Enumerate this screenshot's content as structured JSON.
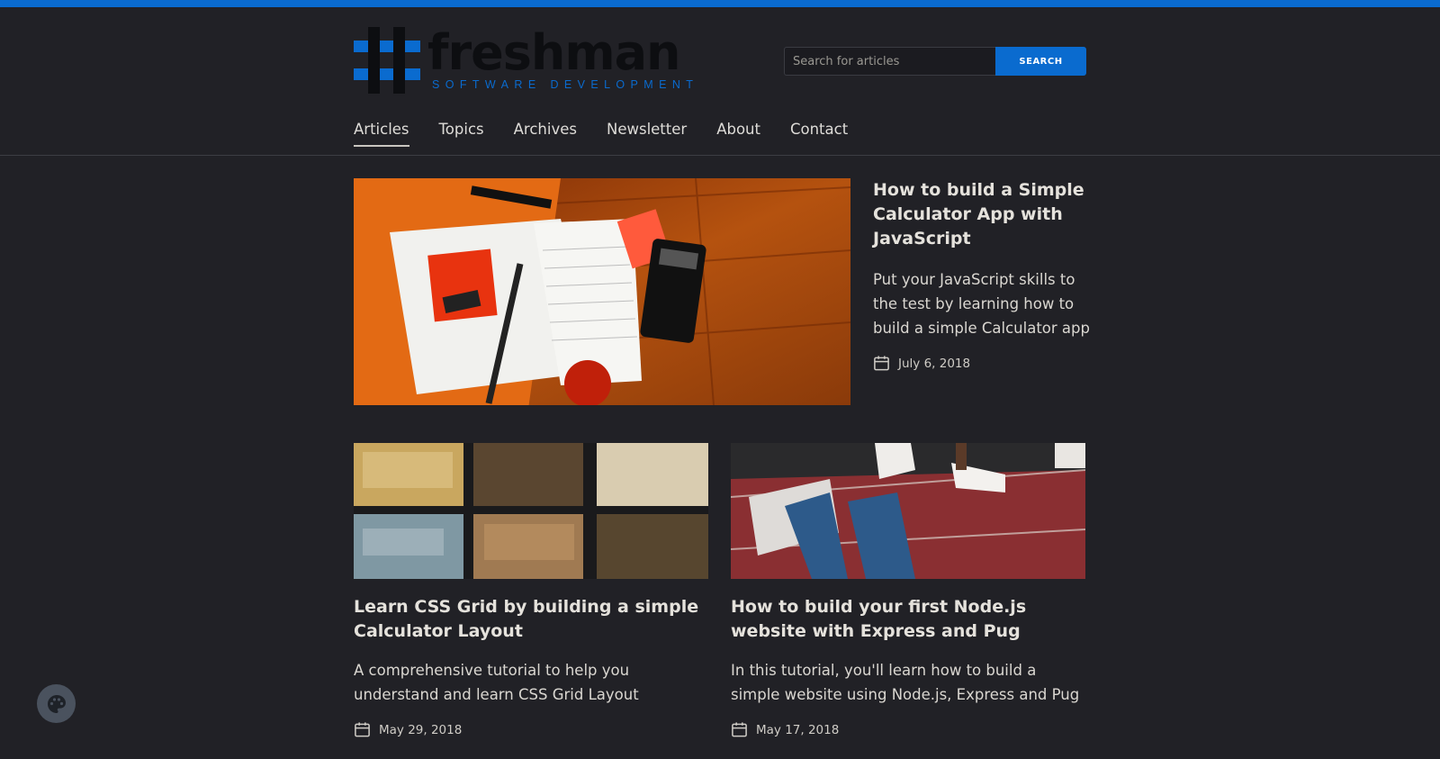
{
  "brand": {
    "name": "freshman",
    "tagline": "SOFTWARE DEVELOPMENT",
    "accent_color": "#0a6bcf"
  },
  "search": {
    "placeholder": "Search for articles",
    "button_label": "SEARCH"
  },
  "nav": {
    "items": [
      {
        "label": "Articles",
        "active": true
      },
      {
        "label": "Topics"
      },
      {
        "label": "Archives"
      },
      {
        "label": "Newsletter"
      },
      {
        "label": "About"
      },
      {
        "label": "Contact"
      }
    ]
  },
  "featured": {
    "title": "How to build a Simple Calculator App with JavaScript",
    "description": "Put your JavaScript skills to the test by learning how to build a simple Calculator app",
    "date": "July 6, 2018",
    "icon": "calendar-icon"
  },
  "articles": [
    {
      "title": "Learn CSS Grid by building a simple Calculator Layout",
      "description": "A comprehensive tutorial to help you understand and learn CSS Grid Layout",
      "date": "May 29, 2018",
      "icon": "calendar-icon"
    },
    {
      "title": "How to build your first Node.js website with Express and Pug",
      "description": "In this tutorial, you'll learn how to build a simple website using Node.js, Express and Pug",
      "date": "May 17, 2018",
      "icon": "calendar-icon"
    }
  ],
  "theme_toggle": {
    "icon": "palette-icon"
  }
}
